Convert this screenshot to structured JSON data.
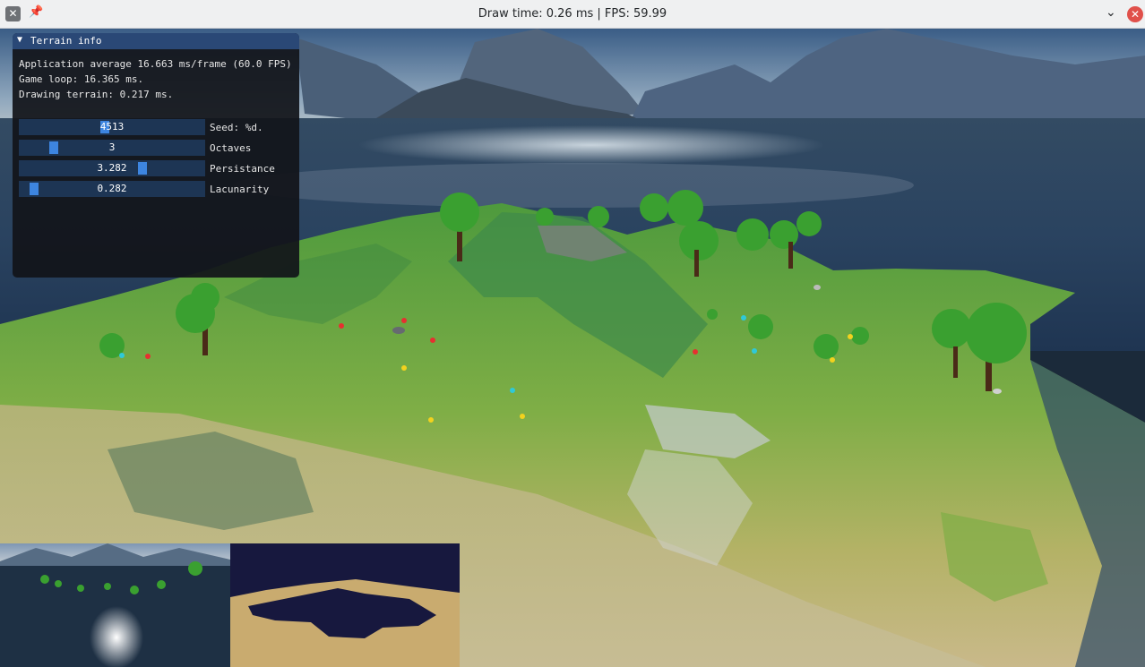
{
  "window": {
    "title": "Draw time: 0.26 ms | FPS: 59.99",
    "app_icon": "window-app-icon",
    "pin_icon": "pin-icon",
    "minimize_icon": "chevron-down-icon",
    "close_icon": "close-icon"
  },
  "panel": {
    "title": "Terrain info",
    "lines": [
      "Application average 16.663 ms/frame (60.0 FPS)",
      "Game loop: 16.365 ms.",
      "Drawing terrain: 0.217 ms."
    ],
    "sliders": [
      {
        "value": "4513",
        "label": "Seed: %d.",
        "level": 0.46
      },
      {
        "value": "3",
        "label": "Octaves",
        "level": 0.17
      },
      {
        "value": "3.282",
        "label": "Persistance",
        "level": 0.67
      },
      {
        "value": "0.282",
        "label": "Lacunarity",
        "level": 0.06
      }
    ]
  },
  "colors": {
    "panel_header": "#2a4876",
    "slider_bg": "#1d3554",
    "slider_grab": "#3d85e0",
    "close_button": "#e0504a"
  }
}
